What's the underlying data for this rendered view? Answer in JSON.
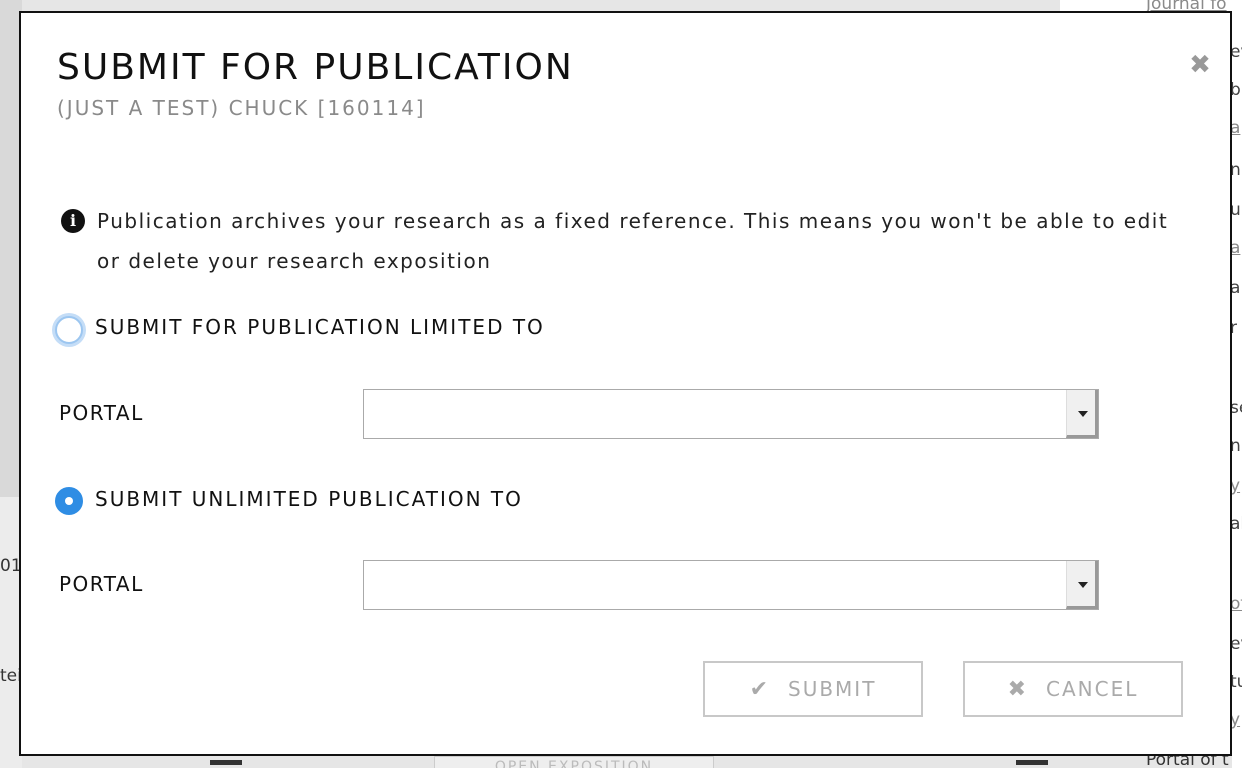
{
  "modal": {
    "title": "SUBMIT FOR PUBLICATION",
    "subtitle": "(JUST A TEST) CHUCK [160114]",
    "close_icon": "close-icon",
    "info_icon": "info-icon",
    "info_text": "Publication archives your research as a fixed reference. This means you won't be able to edit or delete your research exposition",
    "options": [
      {
        "label": "SUBMIT FOR PUBLICATION LIMITED TO",
        "checked": false,
        "field_label": "PORTAL",
        "value": ""
      },
      {
        "label": "SUBMIT UNLIMITED PUBLICATION TO",
        "checked": true,
        "field_label": "PORTAL",
        "value": ""
      }
    ],
    "buttons": {
      "submit_label": "SUBMIT",
      "submit_icon": "check-icon",
      "cancel_label": "CANCEL",
      "cancel_icon": "close-icon"
    },
    "accent_color": "#2f8de4"
  },
  "background": {
    "left_fragments": [
      "01",
      "tei"
    ],
    "right_fragments": [
      "Journal fo",
      "ev",
      "bl",
      "a",
      "n",
      "u",
      "a",
      "a",
      "r",
      "se",
      "n",
      "y",
      "al",
      "of",
      "ev",
      "tu",
      "y"
    ],
    "bottom_button": "OPEN EXPOSITION",
    "bottom_right_text": "Portal of t"
  }
}
